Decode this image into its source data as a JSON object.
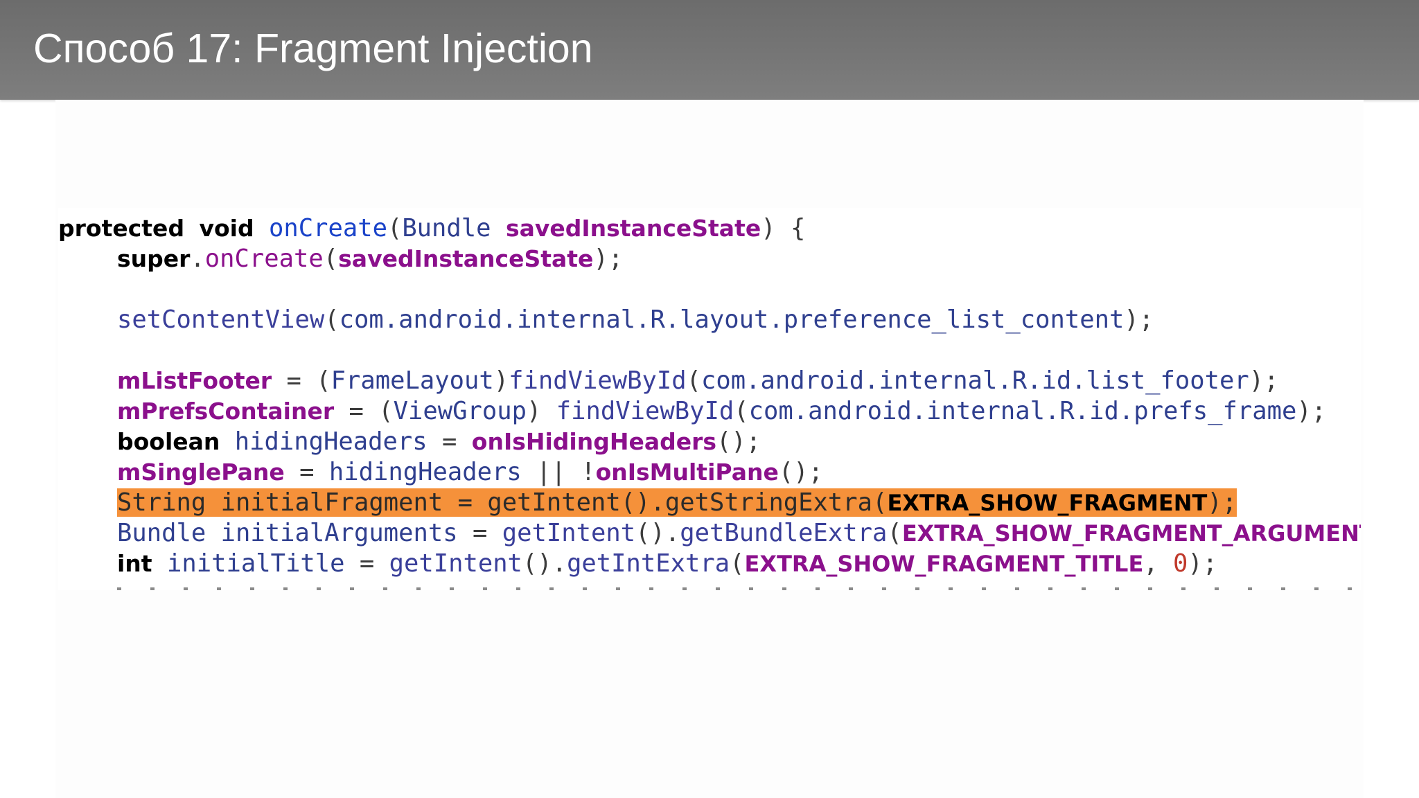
{
  "slide": {
    "title": "Способ 17: Fragment Injection"
  },
  "code": {
    "line1": {
      "protected": "protected",
      "void": "void",
      "name": "onCreate",
      "open": "(",
      "ptype": "Bundle",
      "pname": "savedInstanceState",
      "close": ") {"
    },
    "line2": {
      "super": "super",
      "dot": ".",
      "call": "onCreate",
      "open": "(",
      "arg": "savedInstanceState",
      "close": ");"
    },
    "line3": {
      "call": "setContentView",
      "open": "(",
      "path": "com.android.internal.R.layout.preference_list_content",
      "close": ");"
    },
    "line4": {
      "field": "mListFooter",
      "eq": " = (",
      "cast": "FrameLayout",
      "rp": ")",
      "call": "findViewById",
      "open": "(",
      "path": "com.android.internal.R.id.list_footer",
      "close": ");"
    },
    "line5": {
      "field": "mPrefsContainer",
      "eq": " = (",
      "cast": "ViewGroup",
      "rp": ") ",
      "call": "findViewById",
      "open": "(",
      "path": "com.android.internal.R.id.prefs_frame",
      "close": ");"
    },
    "line6": {
      "type": "boolean",
      "var": " hidingHeaders",
      "eq": " = ",
      "call": "onIsHidingHeaders",
      "close": "();"
    },
    "line7": {
      "field": "mSinglePane",
      "eq": " = ",
      "var": "hidingHeaders",
      "op": " || !",
      "call": "onIsMultiPane",
      "close": "();"
    },
    "line8": {
      "type": "String",
      "var": " initialFragment",
      "eq": " = ",
      "call1": "getIntent",
      "mid": "().",
      "call2": "getStringExtra",
      "open": "(",
      "const": "EXTRA_SHOW_FRAGMENT",
      "close": ");"
    },
    "line9": {
      "type": "Bundle",
      "var": " initialArguments",
      "eq": " = ",
      "call1": "getIntent",
      "mid": "().",
      "call2": "getBundleExtra",
      "open": "(",
      "const": "EXTRA_SHOW_FRAGMENT_ARGUMENTS",
      "close": ");"
    },
    "line10": {
      "type": "int",
      "var": " initialTitle",
      "eq": " = ",
      "call1": "getIntent",
      "mid": "().",
      "call2": "getIntExtra",
      "open": "(",
      "const": "EXTRA_SHOW_FRAGMENT_TITLE",
      "comma": ", ",
      "num": "0",
      "close": ");"
    }
  },
  "colors": {
    "header_bar": "#737373",
    "highlight": "#f5913a",
    "keyword": "#000000",
    "method": "#1a43c9",
    "field": "#8b108c",
    "number": "#c0392b"
  }
}
